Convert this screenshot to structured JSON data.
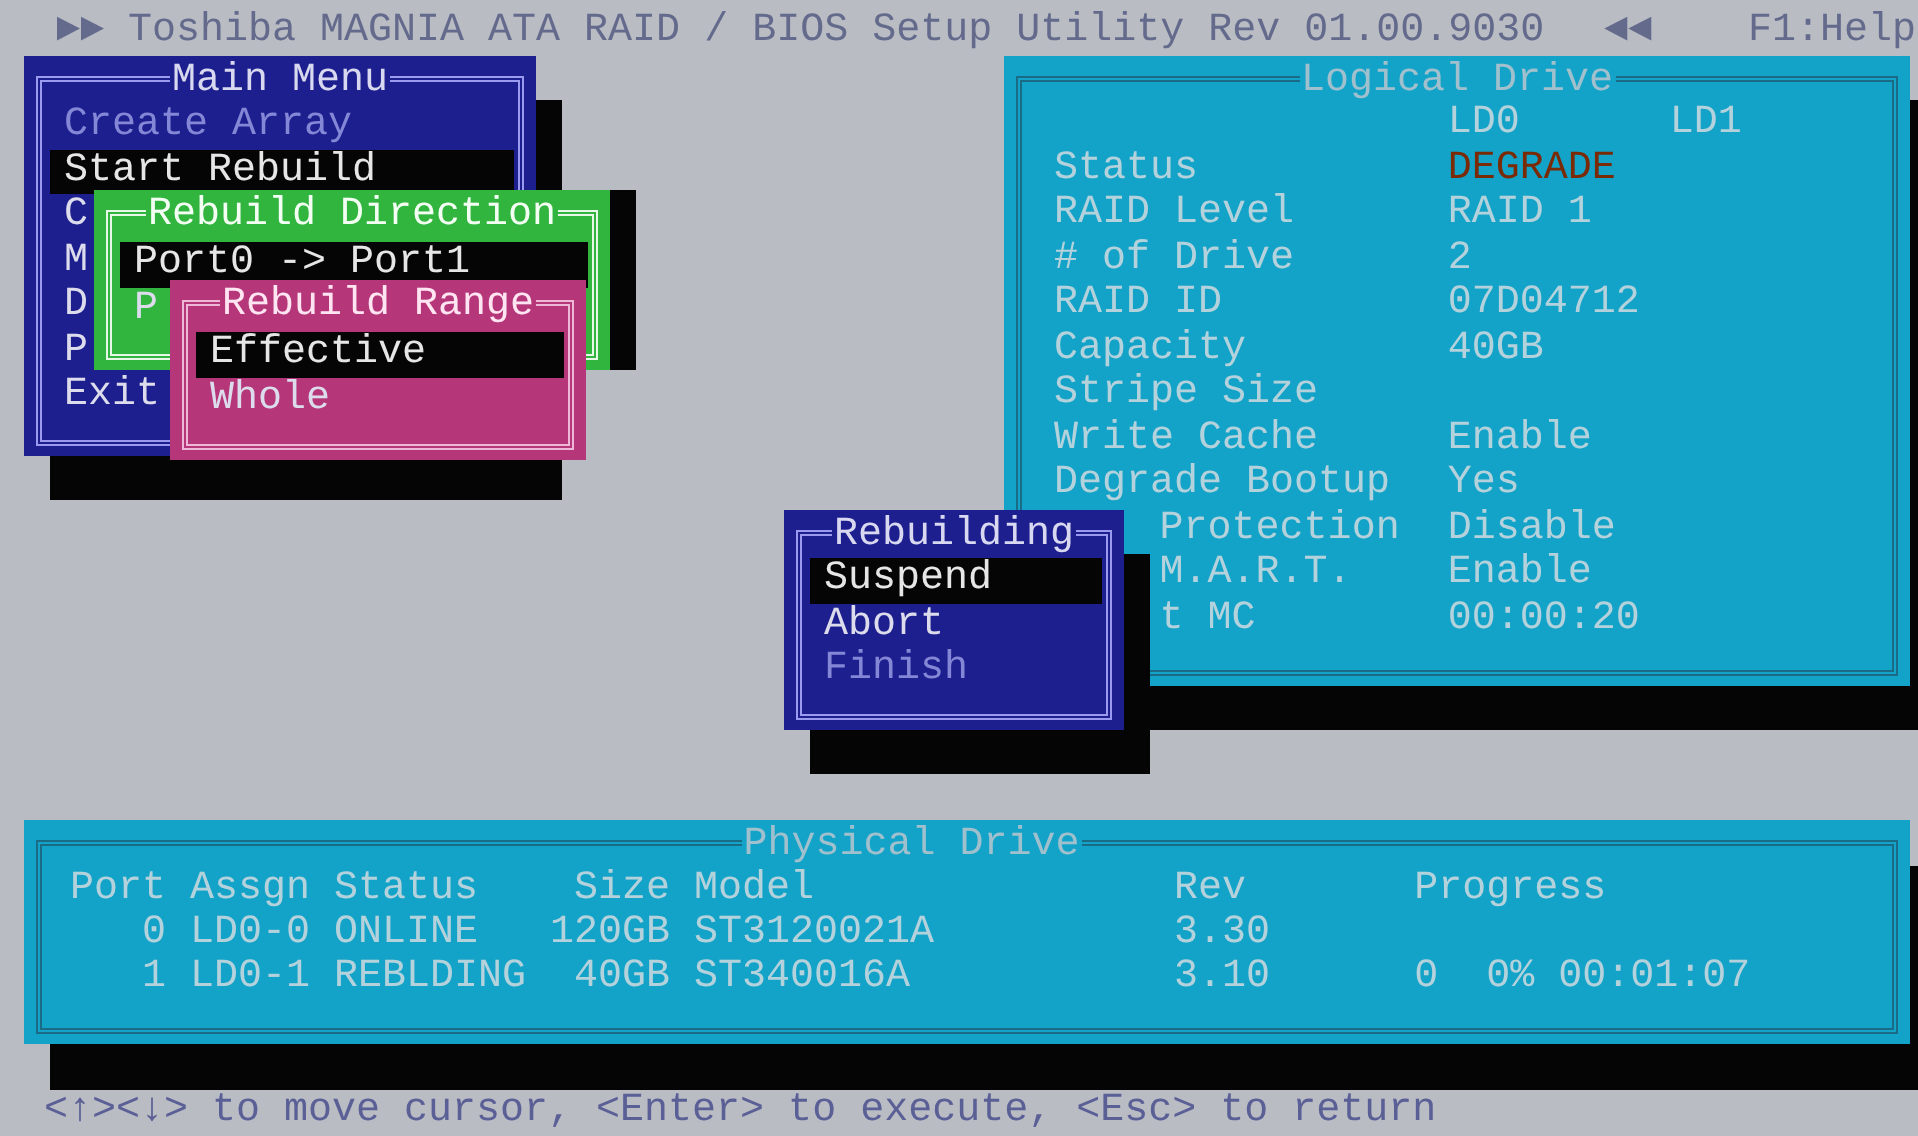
{
  "header": {
    "left_arrows": "►►",
    "title": "Toshiba MAGNIA ATA RAID / BIOS Setup Utility Rev 01.00.9030",
    "right_arrows": "◄◄",
    "help": "F1:Help"
  },
  "main_menu": {
    "title": "Main Menu",
    "items": [
      {
        "label": "Create Array",
        "selected": false,
        "disabled": true
      },
      {
        "label": "Start Rebuild",
        "selected": true,
        "disabled": false
      },
      {
        "label": "C",
        "selected": false,
        "disabled": false
      },
      {
        "label": "M",
        "selected": false,
        "disabled": false
      },
      {
        "label": "D",
        "selected": false,
        "disabled": false
      },
      {
        "label": "P",
        "selected": false,
        "disabled": false
      },
      {
        "label": "Exit",
        "selected": false,
        "disabled": false
      }
    ]
  },
  "rebuild_direction": {
    "title": "Rebuild Direction",
    "items": [
      {
        "label": "Port0 -> Port1",
        "selected": true,
        "disabled": false
      },
      {
        "label": "P",
        "selected": false,
        "disabled": false
      }
    ]
  },
  "rebuild_range": {
    "title": "Rebuild Range",
    "items": [
      {
        "label": "Effective",
        "selected": true,
        "disabled": false
      },
      {
        "label": "Whole",
        "selected": false,
        "disabled": false
      }
    ]
  },
  "logical_drive": {
    "title": "Logical Drive",
    "columns": [
      "LD0",
      "LD1"
    ],
    "rows": [
      {
        "kind": "full",
        "label": "Status",
        "value": "DEGRADE",
        "highlight": true
      },
      {
        "kind": "full",
        "label": "RAID Level",
        "value": "RAID 1",
        "highlight": false
      },
      {
        "kind": "full",
        "label": "# of Drive",
        "value": "2",
        "highlight": false
      },
      {
        "kind": "full",
        "label": "RAID ID",
        "value": "07D04712",
        "highlight": false
      },
      {
        "kind": "full",
        "label": "Capacity",
        "value": "40GB",
        "highlight": false
      },
      {
        "kind": "full",
        "label": "Stripe Size"
      },
      {
        "kind": "full",
        "label": "Write Cache",
        "value": "Enable",
        "highlight": false
      },
      {
        "kind": "full",
        "label": "Degrade Bootup",
        "value": "Yes",
        "highlight": false
      },
      {
        "kind": "covered",
        "label": "Protection",
        "value": "Disable",
        "highlight": false
      },
      {
        "kind": "covered",
        "label": "M.A.R.T.",
        "value": "Enable",
        "highlight": false
      },
      {
        "kind": "covered",
        "label": "t MC",
        "value": "00:00:20",
        "highlight": false
      }
    ]
  },
  "rebuilding": {
    "title": "Rebuilding",
    "items": [
      {
        "label": "Suspend",
        "selected": true,
        "disabled": false
      },
      {
        "label": "Abort",
        "selected": false,
        "disabled": false
      },
      {
        "label": "Finish",
        "selected": false,
        "disabled": true
      }
    ]
  },
  "physical_drive": {
    "title": "Physical Drive",
    "columns": [
      "Port",
      "Assgn",
      "Status",
      "Size",
      "Model",
      "Rev",
      "Progress"
    ],
    "rows": [
      [
        "0",
        "LD0-0",
        "ONLINE",
        "120GB",
        "ST3120021A",
        "3.30"
      ],
      [
        "1",
        "LD0-1",
        "REBLDING",
        "40GB",
        "ST340016A",
        "3.10",
        "0  0% 00:01:07"
      ]
    ]
  },
  "status_bar": "<↑><↓> to move cursor, <Enter> to execute, <Esc> to return"
}
